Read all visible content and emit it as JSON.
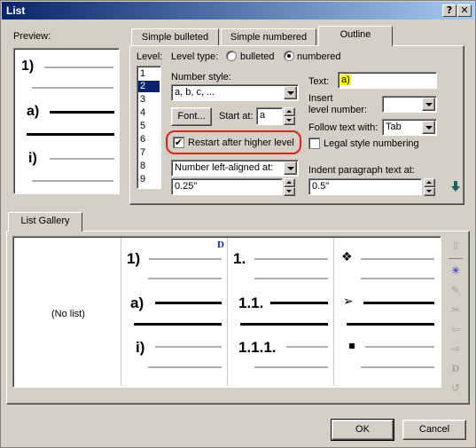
{
  "window": {
    "title": "List",
    "help_btn": "?",
    "close_btn": "✕"
  },
  "preview": {
    "label": "Preview:",
    "items": [
      "1)",
      "a)",
      "i)"
    ]
  },
  "tabs": [
    {
      "label": "Simple bulleted"
    },
    {
      "label": "Simple numbered"
    },
    {
      "label": "Outline"
    }
  ],
  "level": {
    "label": "Level:",
    "items": [
      "1",
      "2",
      "3",
      "4",
      "5",
      "6",
      "7",
      "8",
      "9"
    ],
    "selected": "2"
  },
  "level_type": {
    "label": "Level type:",
    "bulleted": "bulleted",
    "numbered": "numbered",
    "selected": "numbered"
  },
  "number_style": {
    "label": "Number style:",
    "value": "a, b, c, ..."
  },
  "font_button": "Font...",
  "start_at": {
    "label": "Start at:",
    "value": "a"
  },
  "restart_after_higher": {
    "label": "Restart after higher level",
    "checked": true
  },
  "alignment": {
    "value": "Number left-aligned at:",
    "indent_value": "0.25\""
  },
  "text_field": {
    "label": "Text:",
    "value": "a)"
  },
  "insert_level": {
    "label1": "Insert",
    "label2": "level number:"
  },
  "follow_text": {
    "label": "Follow text with:",
    "value": "Tab"
  },
  "legal_style": {
    "label": "Legal style numbering",
    "checked": false
  },
  "indent_text": {
    "label": "Indent paragraph text at:",
    "value": "0.5\""
  },
  "gallery": {
    "tab_label": "List Gallery",
    "no_list": "(No list)",
    "col2": [
      "1)",
      "a)",
      "i)"
    ],
    "col2_badge": "D",
    "col3": [
      "1.",
      "1.1.",
      "1.1.1."
    ],
    "col4": [
      "❖",
      "➢",
      "▪"
    ]
  },
  "buttons": {
    "ok": "OK",
    "cancel": "Cancel"
  }
}
